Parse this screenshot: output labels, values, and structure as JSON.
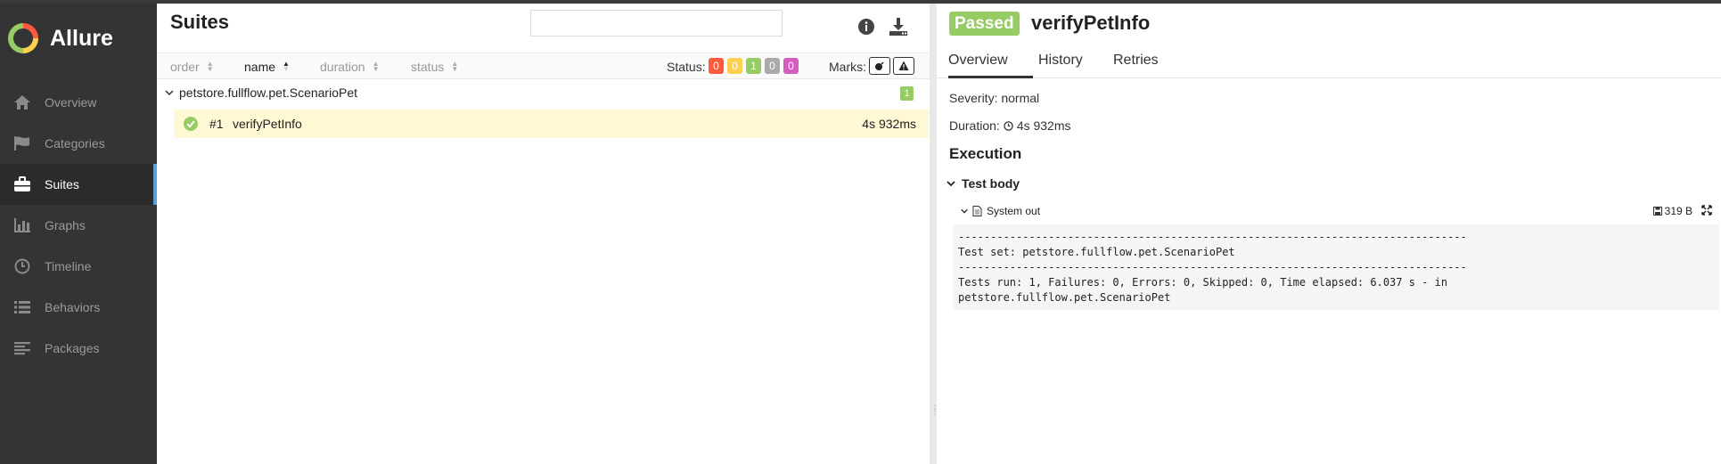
{
  "app": {
    "name": "Allure"
  },
  "sidebar": {
    "items": [
      {
        "label": "Overview",
        "icon": "home-icon",
        "active": false
      },
      {
        "label": "Categories",
        "icon": "flag-icon",
        "active": false
      },
      {
        "label": "Suites",
        "icon": "briefcase-icon",
        "active": true
      },
      {
        "label": "Graphs",
        "icon": "bar-chart-icon",
        "active": false
      },
      {
        "label": "Timeline",
        "icon": "clock-icon",
        "active": false
      },
      {
        "label": "Behaviors",
        "icon": "list-icon",
        "active": false
      },
      {
        "label": "Packages",
        "icon": "align-left-icon",
        "active": false
      }
    ]
  },
  "suites": {
    "title": "Suites",
    "search": {
      "value": "",
      "placeholder": ""
    },
    "sort": {
      "order": "order",
      "name": "name",
      "duration": "duration",
      "status": "status"
    },
    "status_label": "Status:",
    "status_counts": [
      {
        "value": "0",
        "color": "#fd5a3e"
      },
      {
        "value": "0",
        "color": "#ffd050"
      },
      {
        "value": "1",
        "color": "#97cc64"
      },
      {
        "value": "0",
        "color": "#aaaaaa"
      },
      {
        "value": "0",
        "color": "#d35ebe"
      }
    ],
    "marks_label": "Marks:",
    "group": {
      "name": "petstore.fullflow.pet.ScenarioPet",
      "count": "1"
    },
    "test": {
      "number": "#1",
      "name": "verifyPetInfo",
      "duration": "4s 932ms"
    }
  },
  "detail": {
    "status": "Passed",
    "title": "verifyPetInfo",
    "tabs": [
      "Overview",
      "History",
      "Retries"
    ],
    "severity": "Severity: normal",
    "duration_label": "Duration:",
    "duration_value": "4s 932ms",
    "execution_title": "Execution",
    "test_body": "Test body",
    "attachment": {
      "name": "System out",
      "size": "319 B"
    },
    "console": "-------------------------------------------------------------------------------\nTest set: petstore.fullflow.pet.ScenarioPet\n-------------------------------------------------------------------------------\nTests run: 1, Failures: 0, Errors: 0, Skipped: 0, Time elapsed: 6.037 s - in\npetstore.fullflow.pet.ScenarioPet"
  },
  "colors": {
    "passed": "#97cc64",
    "sidebar_bg": "#343434",
    "active_accent": "#5b9fd6",
    "selected_row": "#fef9d4"
  }
}
